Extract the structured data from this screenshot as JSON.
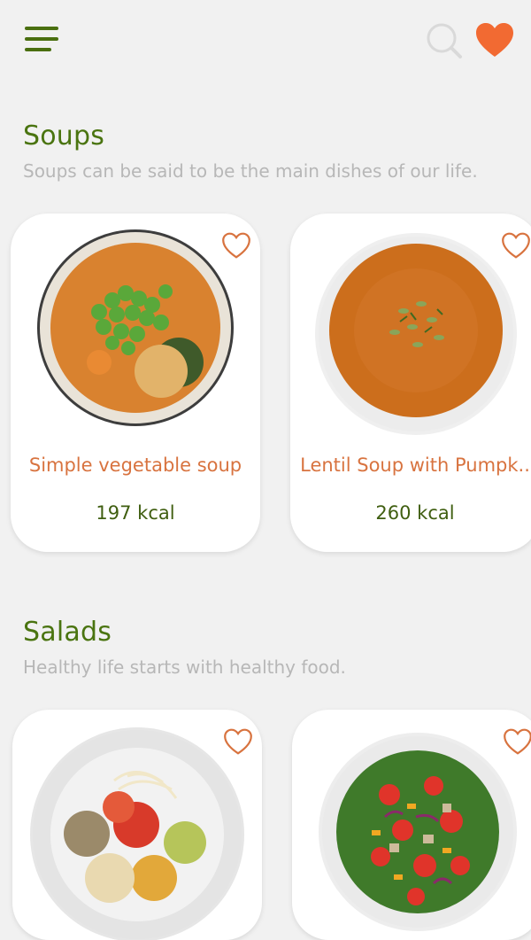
{
  "header": {
    "menu_icon": "hamburger-menu-icon",
    "search_icon": "search-icon",
    "favorites_icon": "heart-filled-icon"
  },
  "colors": {
    "accent_green": "#4a7410",
    "accent_orange": "#f26a32",
    "background": "#f1f1f1",
    "subtitle_gray": "#b7b7b7"
  },
  "sections": [
    {
      "title": "Soups",
      "subtitle": "Soups can be said to be the main dishes of our life.",
      "items": [
        {
          "name": "Simple vegetable soup",
          "kcal": "197 kcal"
        },
        {
          "name": "Lentil Soup with Pumpk..",
          "kcal": "260 kcal"
        }
      ]
    },
    {
      "title": "Salads",
      "subtitle": "Healthy life starts with healthy food.",
      "items": [
        {
          "name": "",
          "kcal": ""
        },
        {
          "name": "",
          "kcal": ""
        }
      ]
    }
  ]
}
